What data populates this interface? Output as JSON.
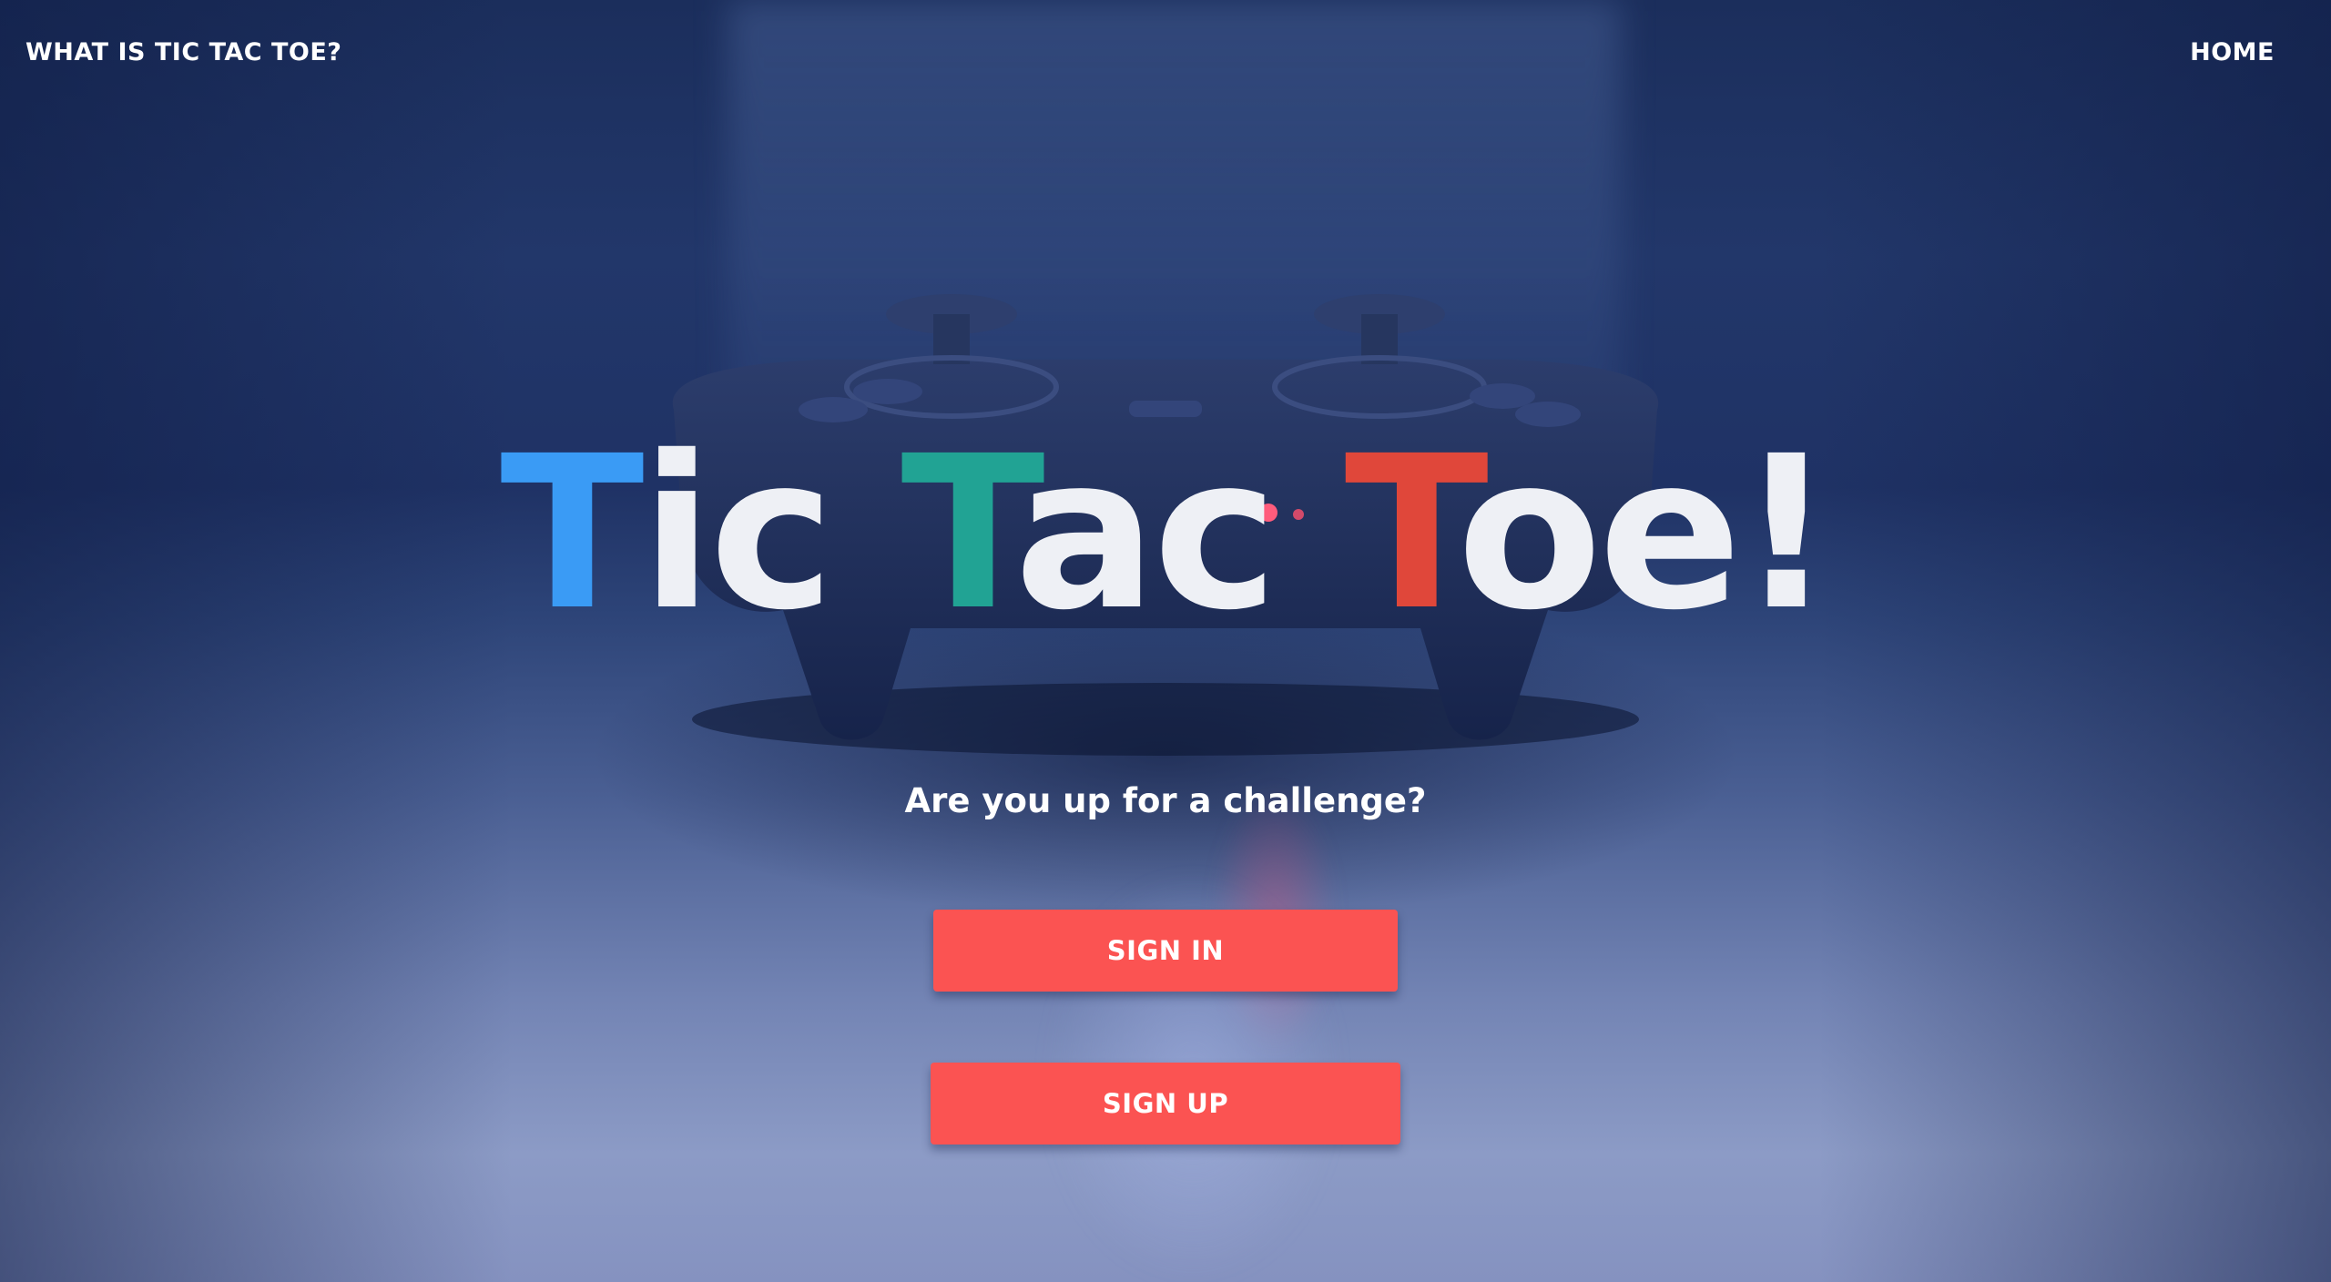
{
  "nav": {
    "left_link": "WHAT IS TIC TAC TOE?",
    "right_link": "HOME"
  },
  "hero": {
    "title_parts": [
      {
        "text": "T",
        "color": "#3a9bf5"
      },
      {
        "text": "ic ",
        "color": "#eef0f5"
      },
      {
        "text": "T",
        "color": "#21a394"
      },
      {
        "text": "ac ",
        "color": "#eef0f5"
      },
      {
        "text": "T",
        "color": "#e0473a"
      },
      {
        "text": "oe!",
        "color": "#eef0f5"
      }
    ],
    "subtitle": "Are you up for a challenge?"
  },
  "buttons": {
    "sign_in": "SIGN IN",
    "sign_up": "SIGN UP"
  },
  "colors": {
    "button_bg": "#fb5352",
    "accent_blue": "#3a9bf5",
    "accent_teal": "#21a394",
    "accent_red": "#e0473a"
  },
  "background": {
    "image_subject": "game-controller-photo"
  }
}
